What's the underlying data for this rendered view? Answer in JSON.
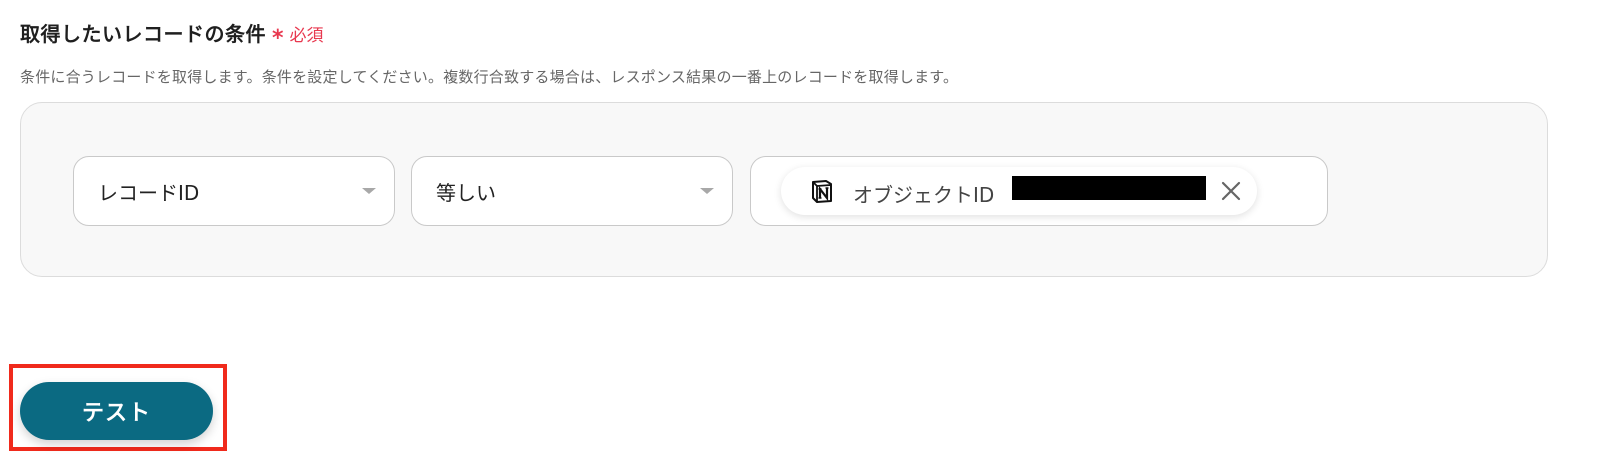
{
  "section": {
    "title": "取得したいレコードの条件",
    "required_star": "*",
    "required_label": "必須",
    "description": "条件に合うレコードを取得します。条件を設定してください。複数行合致する場合は、レスポンス結果の一番上のレコードを取得します。"
  },
  "condition": {
    "field": {
      "selected": "レコードID",
      "icon": "chevron-down-icon"
    },
    "operator": {
      "selected": "等しい",
      "icon": "chevron-down-icon"
    },
    "value": {
      "chip_icon": "notion-icon",
      "chip_label": "オブジェクトID",
      "chip_value_redacted": true,
      "remove_icon": "close-icon"
    }
  },
  "actions": {
    "test_label": "テスト",
    "highlight_color": "#f02a1c",
    "button_color": "#0b6a82"
  },
  "colors": {
    "required": "#e8384f",
    "panel_bg": "#f8f8f8"
  }
}
